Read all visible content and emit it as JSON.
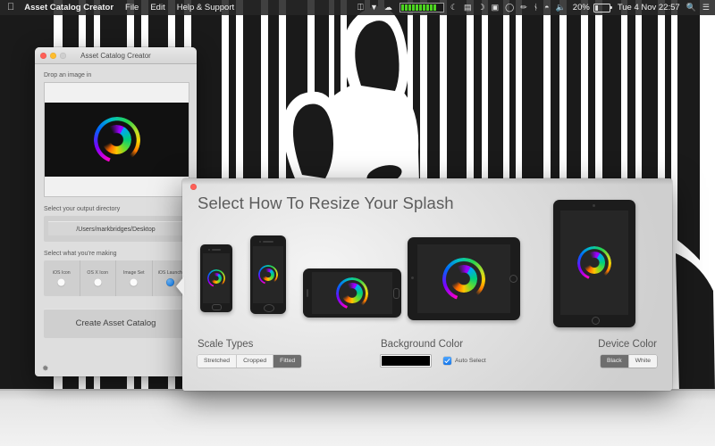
{
  "menubar": {
    "apple_icon": "apple-logo-icon",
    "app_name": "Asset Catalog Creator",
    "menus": [
      "File",
      "Edit",
      "Help & Support"
    ],
    "status_icons": [
      "dropbox-icon",
      "cloud-sync-icon",
      "cloud-icon",
      "cpu-meter-icon",
      "moon-icon",
      "network-activity-icon",
      "flux-icon",
      "bluetooth-file-icon",
      "circle-icon",
      "microphone-icon",
      "bluetooth-icon",
      "wifi-icon",
      "volume-icon"
    ],
    "battery_percent": "20%",
    "datetime": "Tue 4 Nov  22:57",
    "search_icon": "search-icon",
    "notification_icon": "notification-center-icon"
  },
  "app_window": {
    "title": "Asset Catalog Creator",
    "traffic_lights": [
      "close",
      "minimize",
      "zoom"
    ],
    "drop_label": "Drop an image in",
    "output_label": "Select your output directory",
    "output_path": "/Users/markbridges/Desktop",
    "making_label": "Select what you're making",
    "asset_types": [
      {
        "label": "iOS Icon",
        "selected": false
      },
      {
        "label": "OS X Icon",
        "selected": false
      },
      {
        "label": "Image Set",
        "selected": false
      },
      {
        "label": "iOS Launch",
        "selected": true
      }
    ],
    "create_button": "Create Asset Catalog",
    "settings_icon": "gear-icon"
  },
  "dialog": {
    "title": "Select How To Resize Your Splash",
    "close_icon": "close-icon",
    "devices": [
      {
        "name": "iphone-4s-portrait"
      },
      {
        "name": "iphone-5-portrait"
      },
      {
        "name": "iphone-6-landscape"
      },
      {
        "name": "ipad-landscape"
      },
      {
        "name": "ipad-portrait"
      }
    ],
    "scale_types": {
      "label": "Scale Types",
      "options": [
        {
          "label": "Stretched",
          "selected": false
        },
        {
          "label": "Cropped",
          "selected": false
        },
        {
          "label": "Fitted",
          "selected": true
        }
      ]
    },
    "background_color": {
      "label": "Background Color",
      "swatch_hex": "#000000",
      "auto_select_label": "Auto Select",
      "auto_select_checked": true
    },
    "device_color": {
      "label": "Device Color",
      "options": [
        {
          "label": "Black",
          "selected": true
        },
        {
          "label": "White",
          "selected": false
        }
      ]
    }
  },
  "desktop": {
    "wallpaper_name": "zebra-barcode-wallpaper"
  }
}
